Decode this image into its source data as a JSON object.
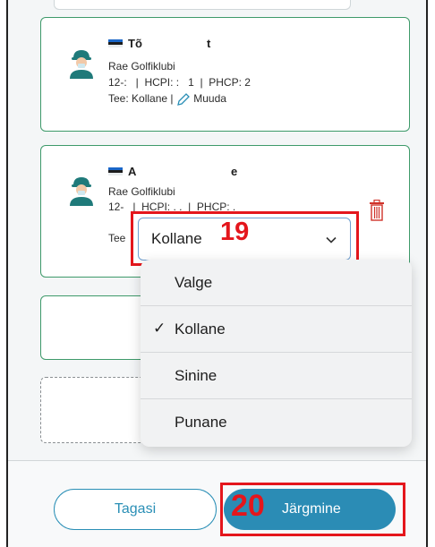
{
  "players": [
    {
      "name": "Tõ",
      "name_tail": "t",
      "club": "Rae Golfiklubi",
      "stats": "12-:   |  HCPI: :   1  |  PHCP: 2",
      "tee_label": "Tee:",
      "tee_value": "Kollane",
      "edit_label": "Muuda"
    },
    {
      "name": "A",
      "name_tail": "e",
      "club": "Rae Golfiklubi",
      "stats": "12-   |  HCPI: . .  |  PHCP: .",
      "tee_label": "Tee"
    }
  ],
  "tee_select": {
    "value": "Kollane",
    "options": [
      "Valge",
      "Kollane",
      "Sinine",
      "Punane"
    ],
    "selected_check": "✓"
  },
  "annotations": {
    "select_step": "19",
    "next_step": "20",
    "color": "#e4161c"
  },
  "footer": {
    "back_label": "Tagasi",
    "next_label": "Järgmine"
  },
  "colors": {
    "card_border": "#3e9a6a",
    "primary": "#2b8cb5"
  }
}
